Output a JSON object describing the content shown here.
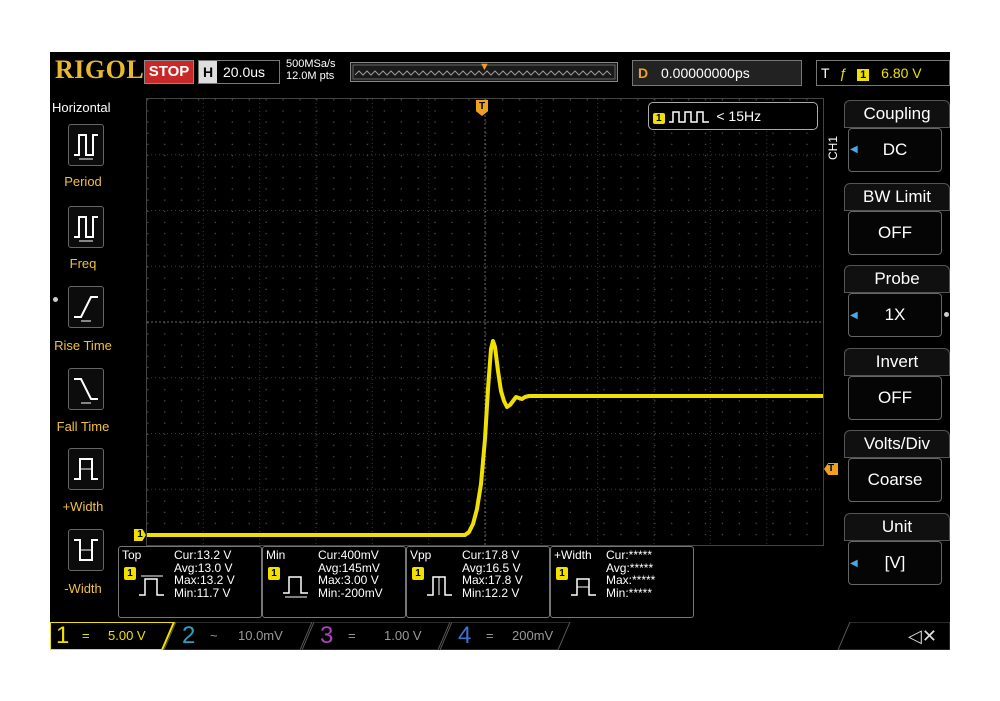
{
  "top_bar": {
    "brand": "RIGOL",
    "run_state": "STOP",
    "horizontal_label": "H",
    "timebase": "20.0us",
    "sample_rate": "500MSa/s",
    "memory_depth": "12.0M pts",
    "delay_label": "D",
    "delay_value": "0.00000000ps",
    "trigger_label": "T",
    "trigger_channel": "1",
    "trigger_level": "6.80 V"
  },
  "left_menu": {
    "title": "Horizontal",
    "items": [
      {
        "label": "Period",
        "icon": "period-icon"
      },
      {
        "label": "Freq",
        "icon": "freq-icon"
      },
      {
        "label": "Rise Time",
        "icon": "rise-time-icon"
      },
      {
        "label": "Fall Time",
        "icon": "fall-time-icon"
      },
      {
        "label": "+Width",
        "icon": "positive-width-icon"
      },
      {
        "label": "-Width",
        "icon": "negative-width-icon"
      }
    ]
  },
  "freq_counter": {
    "channel": "1",
    "text": "< 15Hz"
  },
  "right_menu": {
    "channel_label": "CH1",
    "items": [
      {
        "header": "Coupling",
        "value": "DC"
      },
      {
        "header": "BW Limit",
        "value": "OFF"
      },
      {
        "header": "Probe",
        "value": "1X"
      },
      {
        "header": "Invert",
        "value": "OFF"
      },
      {
        "header": "Volts/Div",
        "value": "Coarse"
      },
      {
        "header": "Unit",
        "value": "[V]"
      }
    ]
  },
  "markers": {
    "trigger_pos": "T",
    "trigger_level": "T",
    "ch1_ground": "1"
  },
  "measurements": [
    {
      "name": "Top",
      "cur": "Cur:13.2 V",
      "avg": "Avg:13.0 V",
      "max": "Max:13.2 V",
      "min": "Min:11.7 V"
    },
    {
      "name": "Min",
      "cur": "Cur:400mV",
      "avg": "Avg:145mV",
      "max": "Max:3.00 V",
      "min": "Min:-200mV"
    },
    {
      "name": "Vpp",
      "cur": "Cur:17.8 V",
      "avg": "Avg:16.5 V",
      "max": "Max:17.8 V",
      "min": "Min:12.2 V"
    },
    {
      "name": "+Width",
      "cur": "Cur:*****",
      "avg": "Avg:*****",
      "max": "Max:*****",
      "min": "Min:*****"
    }
  ],
  "channels": [
    {
      "num": "1",
      "coupling": "=",
      "scale": "5.00 V",
      "color": "#f0e000"
    },
    {
      "num": "2",
      "coupling": "~",
      "scale": "10.0mV",
      "color": "#2aa0c0"
    },
    {
      "num": "3",
      "coupling": "=",
      "scale": "1.00 V",
      "color": "#b040c0"
    },
    {
      "num": "4",
      "coupling": "=",
      "scale": "200mV",
      "color": "#4070d0"
    }
  ],
  "colors": {
    "ch1": "#f0e000",
    "brand": "#e8b830",
    "stop": "#c82828",
    "menu_accent": "#f0c040"
  }
}
